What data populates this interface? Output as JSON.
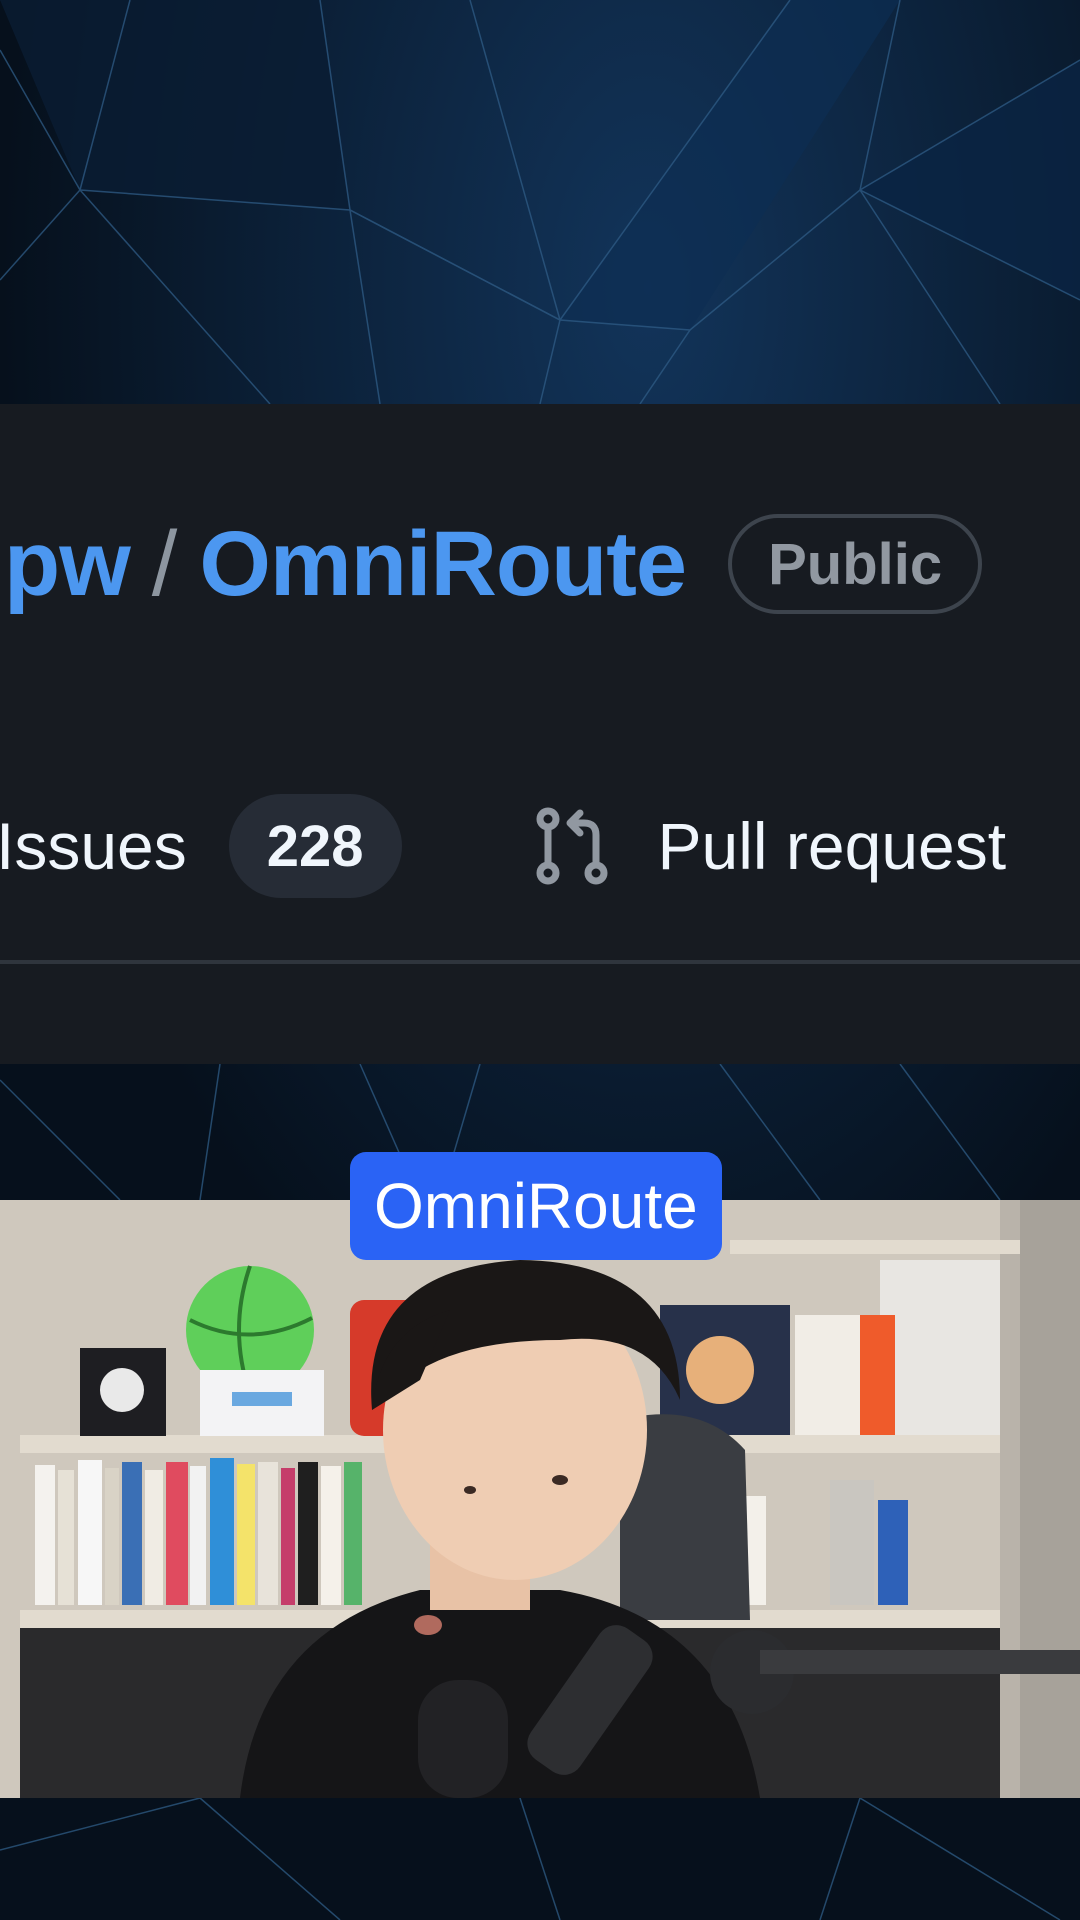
{
  "repo": {
    "owner": "pw",
    "separator": "/",
    "name": "OmniRoute",
    "visibility": "Public"
  },
  "tabs": [
    {
      "label": "Issues",
      "count": "228",
      "icon": "issue-icon"
    },
    {
      "label": "Pull request",
      "icon": "git-pull-request-icon"
    }
  ],
  "caption": "OmniRoute",
  "colors": {
    "link": "#4c97f0",
    "panel_bg": "#171b21",
    "caption_bg": "#2a63f5",
    "background": "#06101c"
  }
}
